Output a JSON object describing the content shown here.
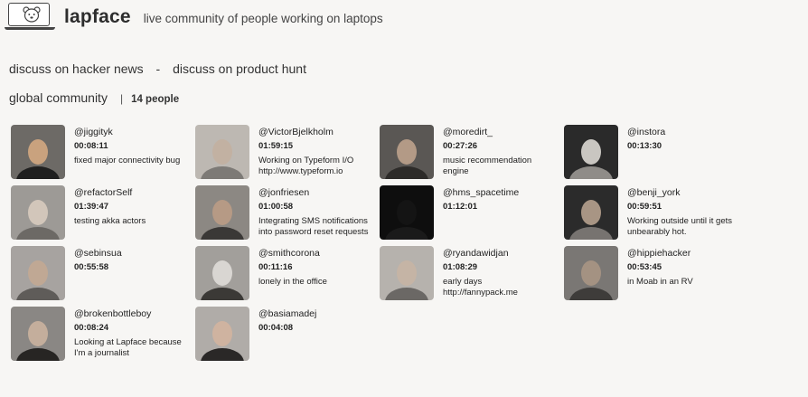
{
  "header": {
    "logo_icon": "bear-laptop-logo",
    "brand": "lapface",
    "tagline": "live community of people working on laptops"
  },
  "links": {
    "hacker_news": "discuss on hacker news",
    "separator": "-",
    "product_hunt": "discuss on product hunt"
  },
  "community": {
    "title": "global community",
    "divider": "|",
    "count": "14 people"
  },
  "members": [
    {
      "handle": "@jiggityk",
      "time": "00:08:11",
      "status": "fixed major connectivity bug"
    },
    {
      "handle": "@VictorBjelkholm",
      "time": "01:59:15",
      "status": "Working on Typeform I/O http://www.typeform.io"
    },
    {
      "handle": "@moredirt_",
      "time": "00:27:26",
      "status": "music recommendation engine"
    },
    {
      "handle": "@instora",
      "time": "00:13:30",
      "status": ""
    },
    {
      "handle": "@refactorSelf",
      "time": "01:39:47",
      "status": "testing akka actors"
    },
    {
      "handle": "@jonfriesen",
      "time": "01:00:58",
      "status": "Integrating SMS notifications into password reset requests"
    },
    {
      "handle": "@hms_spacetime",
      "time": "01:12:01",
      "status": ""
    },
    {
      "handle": "@benji_york",
      "time": "00:59:51",
      "status": "Working outside until it gets unbearably hot."
    },
    {
      "handle": "@sebinsua",
      "time": "00:55:58",
      "status": ""
    },
    {
      "handle": "@smithcorona",
      "time": "00:11:16",
      "status": "lonely in the office"
    },
    {
      "handle": "@ryandawidjan",
      "time": "01:08:29",
      "status": "early days http://fannypack.me"
    },
    {
      "handle": "@hippiehacker",
      "time": "00:53:45",
      "status": "in Moab in an RV"
    },
    {
      "handle": "@brokenbottleboy",
      "time": "00:08:24",
      "status": "Looking at Lapface because I'm a journalist"
    },
    {
      "handle": "@basiamadej",
      "time": "00:04:08",
      "status": ""
    }
  ]
}
